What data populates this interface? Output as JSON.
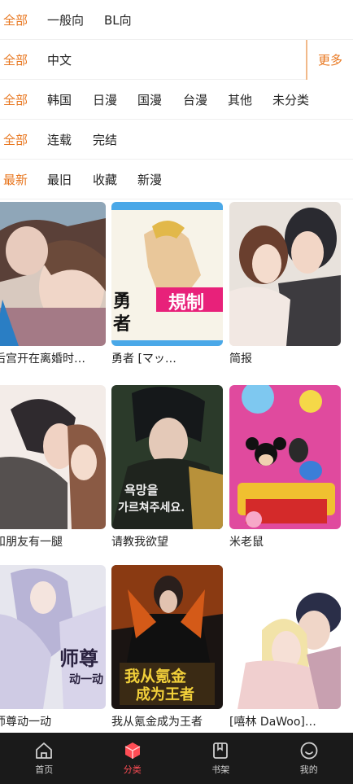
{
  "filters": {
    "audience": [
      "全部",
      "一般向",
      "BL向"
    ],
    "language": [
      "全部",
      "中文"
    ],
    "more_label": "更多",
    "region": [
      "全部",
      "韩国",
      "日漫",
      "国漫",
      "台漫",
      "其他",
      "未分类"
    ],
    "status": [
      "全部",
      "连载",
      "完结"
    ],
    "sort": [
      "最新",
      "最旧",
      "收藏",
      "新漫"
    ]
  },
  "comics": [
    {
      "title": "后宫开在离婚时…"
    },
    {
      "title": "勇者 [マッ…",
      "cover_text_a": "勇",
      "cover_text_b": "者",
      "cover_banner": "規制"
    },
    {
      "title": "简报"
    },
    {
      "title": "和朋友有一腿"
    },
    {
      "title": "请教我欲望",
      "cover_text_a": "욕망을",
      "cover_text_b": "가르쳐주세요."
    },
    {
      "title": "米老鼠"
    },
    {
      "title": "师尊动一动",
      "cover_text_a": "师尊",
      "cover_text_b": "动一动"
    },
    {
      "title": "我从氪金成为王者",
      "cover_text_a": "我从氪金",
      "cover_text_b": "成为王者"
    },
    {
      "title": "[嘻林 DaWoo]…"
    }
  ],
  "tabbar": {
    "home": "首页",
    "category": "分类",
    "shelf": "书架",
    "mine": "我的"
  },
  "colors": {
    "accent": "#e8761e",
    "tab_active": "#ff4d55",
    "tabbar_bg": "#1a1a1a"
  }
}
